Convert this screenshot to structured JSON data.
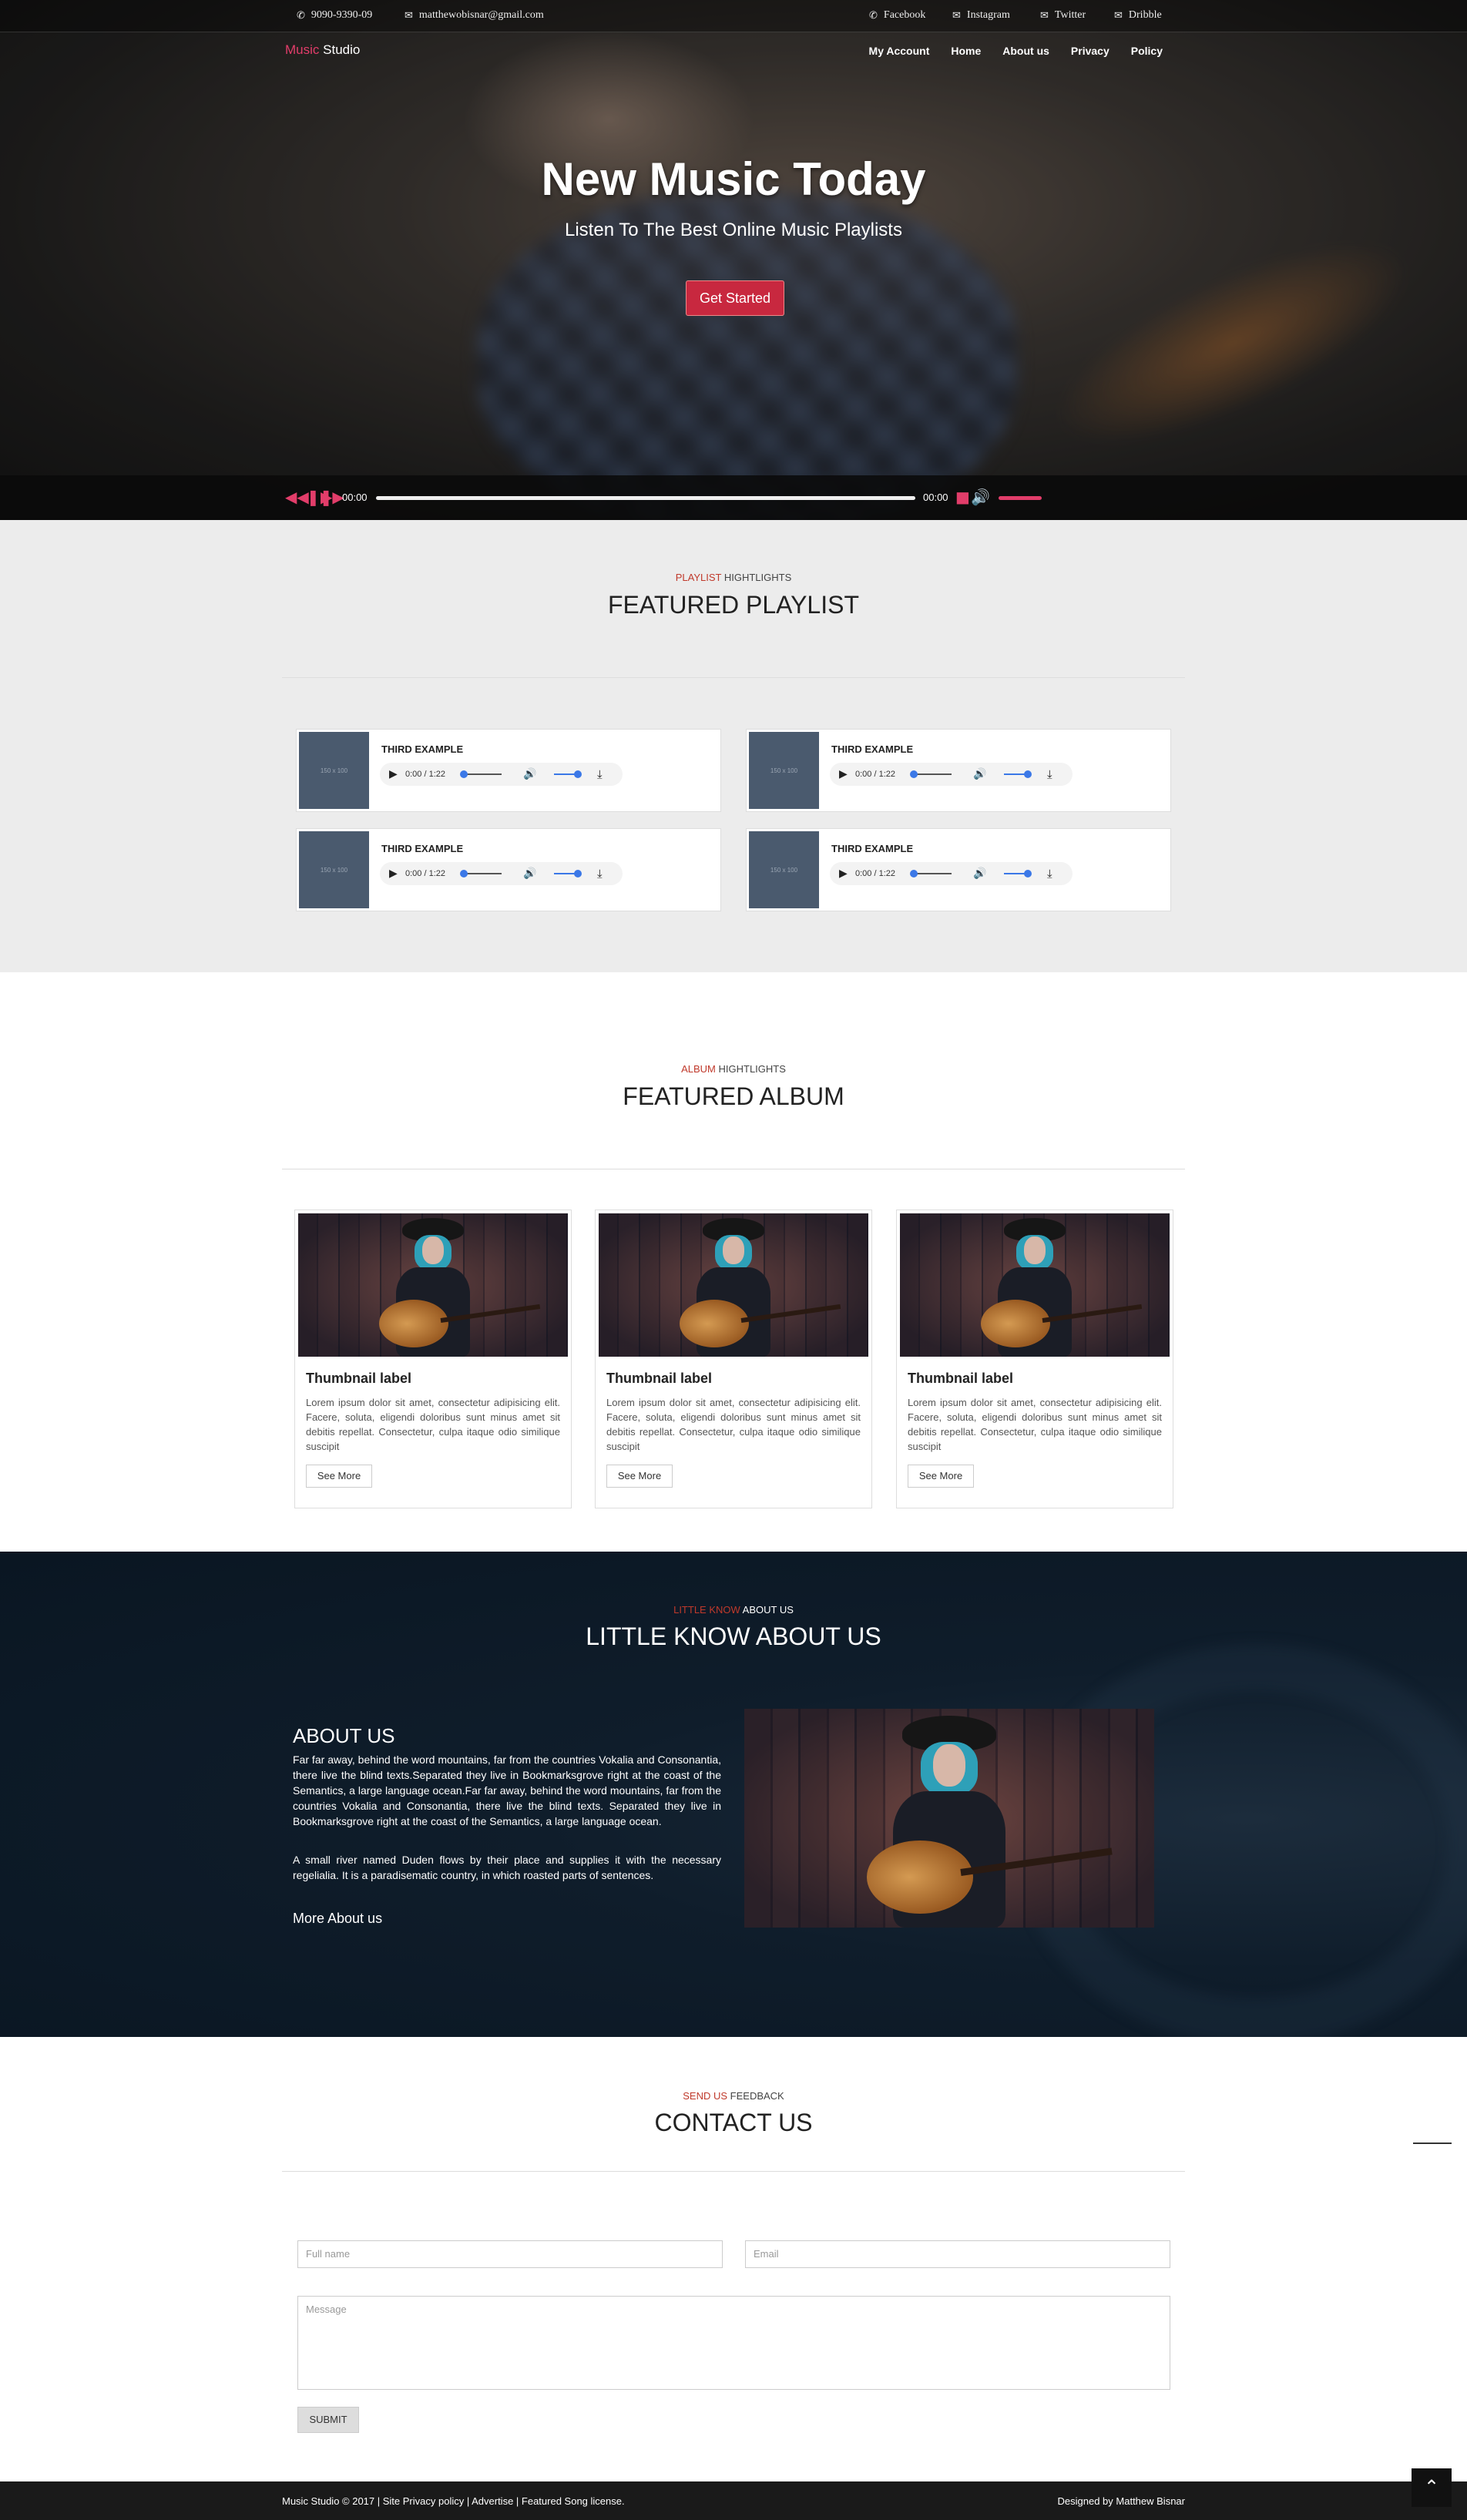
{
  "topbar": {
    "phone": "9090-9390-09",
    "email": "matthewobisnar@gmail.com",
    "socials": [
      "Facebook",
      "Instagram",
      "Twitter",
      "Dribble"
    ]
  },
  "brand": {
    "accent": "Music",
    "rest": " Studio"
  },
  "nav": [
    "My Account",
    "Home",
    "About us",
    "Privacy",
    "Policy"
  ],
  "hero": {
    "title": "New Music Today",
    "subtitle": "Listen To The Best Online Music Playlists",
    "cta": "Get Started"
  },
  "player": {
    "current_time": "00:00",
    "duration": "00:00",
    "progress": 0,
    "volume": 1.0
  },
  "playlist_section": {
    "kicker_red": "PLAYLIST",
    "kicker_rest": " HIGHTLIGHTS",
    "title": "FEATURED PLAYLIST",
    "items": [
      {
        "title": "THIRD EXAMPLE",
        "thumb": "150 x 100",
        "time": "0:00 / 1:22"
      },
      {
        "title": "THIRD EXAMPLE",
        "thumb": "150 x 100",
        "time": "0:00 / 1:22"
      },
      {
        "title": "THIRD EXAMPLE",
        "thumb": "150 x 100",
        "time": "0:00 / 1:22"
      },
      {
        "title": "THIRD EXAMPLE",
        "thumb": "150 x 100",
        "time": "0:00 / 1:22"
      }
    ]
  },
  "album_section": {
    "kicker_red": "ALBUM",
    "kicker_rest": " HIGHTLIGHTS",
    "title": "FEATURED ALBUM",
    "cards": [
      {
        "label": "Thumbnail label",
        "text": "Lorem ipsum dolor sit amet, consectetur adipisicing elit. Facere, soluta, eligendi doloribus sunt minus amet sit debitis repellat. Consectetur, culpa itaque odio similique suscipit",
        "button": "See More"
      },
      {
        "label": "Thumbnail label",
        "text": "Lorem ipsum dolor sit amet, consectetur adipisicing elit. Facere, soluta, eligendi doloribus sunt minus amet sit debitis repellat. Consectetur, culpa itaque odio similique suscipit",
        "button": "See More"
      },
      {
        "label": "Thumbnail label",
        "text": "Lorem ipsum dolor sit amet, consectetur adipisicing elit. Facere, soluta, eligendi doloribus sunt minus amet sit debitis repellat. Consectetur, culpa itaque odio similique suscipit",
        "button": "See More"
      }
    ]
  },
  "about_section": {
    "kicker_red": "LITTLE KNOW",
    "kicker_rest": " ABOUT US",
    "title": "LITTLE KNOW ABOUT US",
    "heading": "ABOUT US",
    "para1": "Far far away, behind the word mountains, far from the countries Vokalia and Consonantia, there live the blind texts.Separated they live in Bookmarksgrove right at the coast of the Semantics, a large language ocean.Far far away, behind the word mountains, far from the countries Vokalia and Consonantia, there live the blind texts. Separated they live in Bookmarksgrove right at the coast of the Semantics, a large language ocean.",
    "para2": "A small river named Duden flows by their place and supplies it with the necessary regelialia. It is a paradisematic country, in which roasted parts of sentences.",
    "more": "More About us"
  },
  "contact_section": {
    "kicker_red": "SEND US",
    "kicker_rest": " FEEDBACK",
    "title": "CONTACT US",
    "fullname_placeholder": "Full name",
    "email_placeholder": "Email",
    "message_placeholder": "Message",
    "submit": "SUBMIT"
  },
  "footer": {
    "left": "Music Studio © 2017 | Site Privacy policy | Advertise | Featured Song license.",
    "right": "Designed by Matthew Bisnar"
  },
  "colors": {
    "accent": "#e23d6a",
    "cta": "#c8283f",
    "kicker_red": "#c0392b",
    "about_bg": "#0f1d2b",
    "playlist_bg": "#ececec"
  },
  "icons": [
    "phone-icon",
    "envelope-icon",
    "rewind-icon",
    "pause-icon",
    "forward-icon",
    "stop-icon",
    "volume-icon",
    "play-icon",
    "download-icon",
    "arrow-up-icon"
  ]
}
